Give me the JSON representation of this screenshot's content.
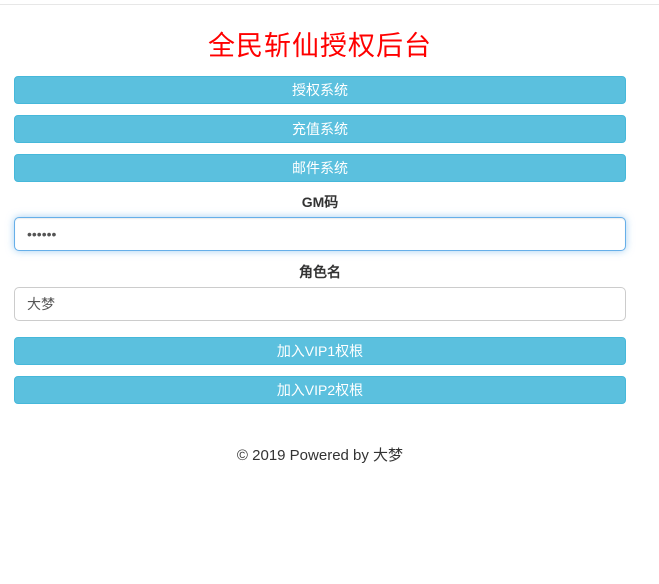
{
  "page": {
    "title": "全民斩仙授权后台"
  },
  "nav_buttons": [
    {
      "label": "授权系统"
    },
    {
      "label": "充值系统"
    },
    {
      "label": "邮件系统"
    }
  ],
  "form": {
    "gm_label": "GM码",
    "gm_value": "••••••",
    "role_label": "角色名",
    "role_value": "大梦"
  },
  "action_buttons": [
    {
      "label": "加入VIP1权根"
    },
    {
      "label": "加入VIP2权根"
    }
  ],
  "footer": {
    "text": "© 2019 Powered by 大梦"
  },
  "colors": {
    "accent": "#5bc0de",
    "accent_border": "#46b8da",
    "title": "#ff0000",
    "focus_border": "#66afe9",
    "input_border": "#cccccc"
  }
}
